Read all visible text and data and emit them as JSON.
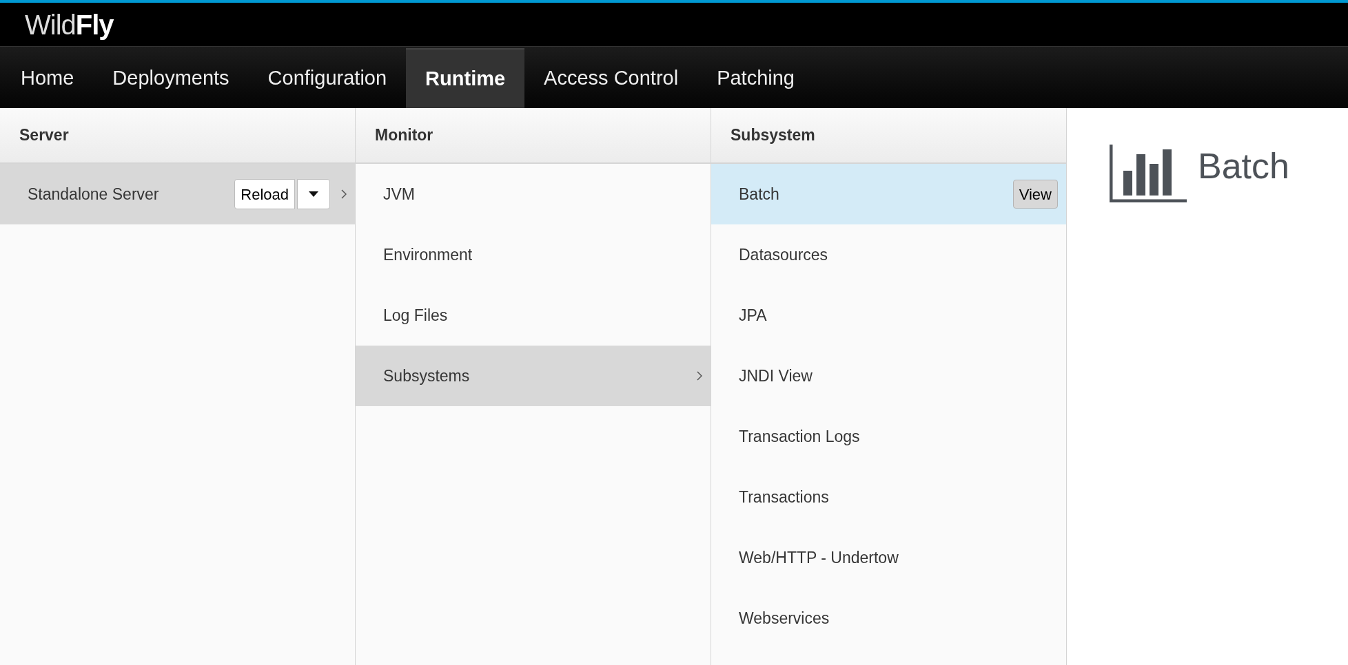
{
  "brand": {
    "light": "Wild",
    "bold": "Fly"
  },
  "nav": [
    {
      "label": "Home",
      "selected": false
    },
    {
      "label": "Deployments",
      "selected": false
    },
    {
      "label": "Configuration",
      "selected": false
    },
    {
      "label": "Runtime",
      "selected": true
    },
    {
      "label": "Access Control",
      "selected": false
    },
    {
      "label": "Patching",
      "selected": false
    }
  ],
  "columns": [
    {
      "title": "Server",
      "kind": "browse",
      "items": [
        {
          "label": "Standalone Server",
          "selected": true,
          "button": "Reload",
          "dropdown": true
        }
      ]
    },
    {
      "title": "Monitor",
      "kind": "browse",
      "items": [
        {
          "label": "JVM",
          "selected": false
        },
        {
          "label": "Environment",
          "selected": false
        },
        {
          "label": "Log Files",
          "selected": false
        },
        {
          "label": "Subsystems",
          "selected": true
        }
      ]
    },
    {
      "title": "Subsystem",
      "kind": "leaf",
      "items": [
        {
          "label": "Batch",
          "selected": true,
          "button": "View"
        },
        {
          "label": "Datasources",
          "selected": false
        },
        {
          "label": "JPA",
          "selected": false
        },
        {
          "label": "JNDI View",
          "selected": false
        },
        {
          "label": "Transaction Logs",
          "selected": false
        },
        {
          "label": "Transactions",
          "selected": false
        },
        {
          "label": "Web/HTTP - Undertow",
          "selected": false
        },
        {
          "label": "Webservices",
          "selected": false
        }
      ]
    }
  ],
  "preview": {
    "title": "Batch"
  }
}
